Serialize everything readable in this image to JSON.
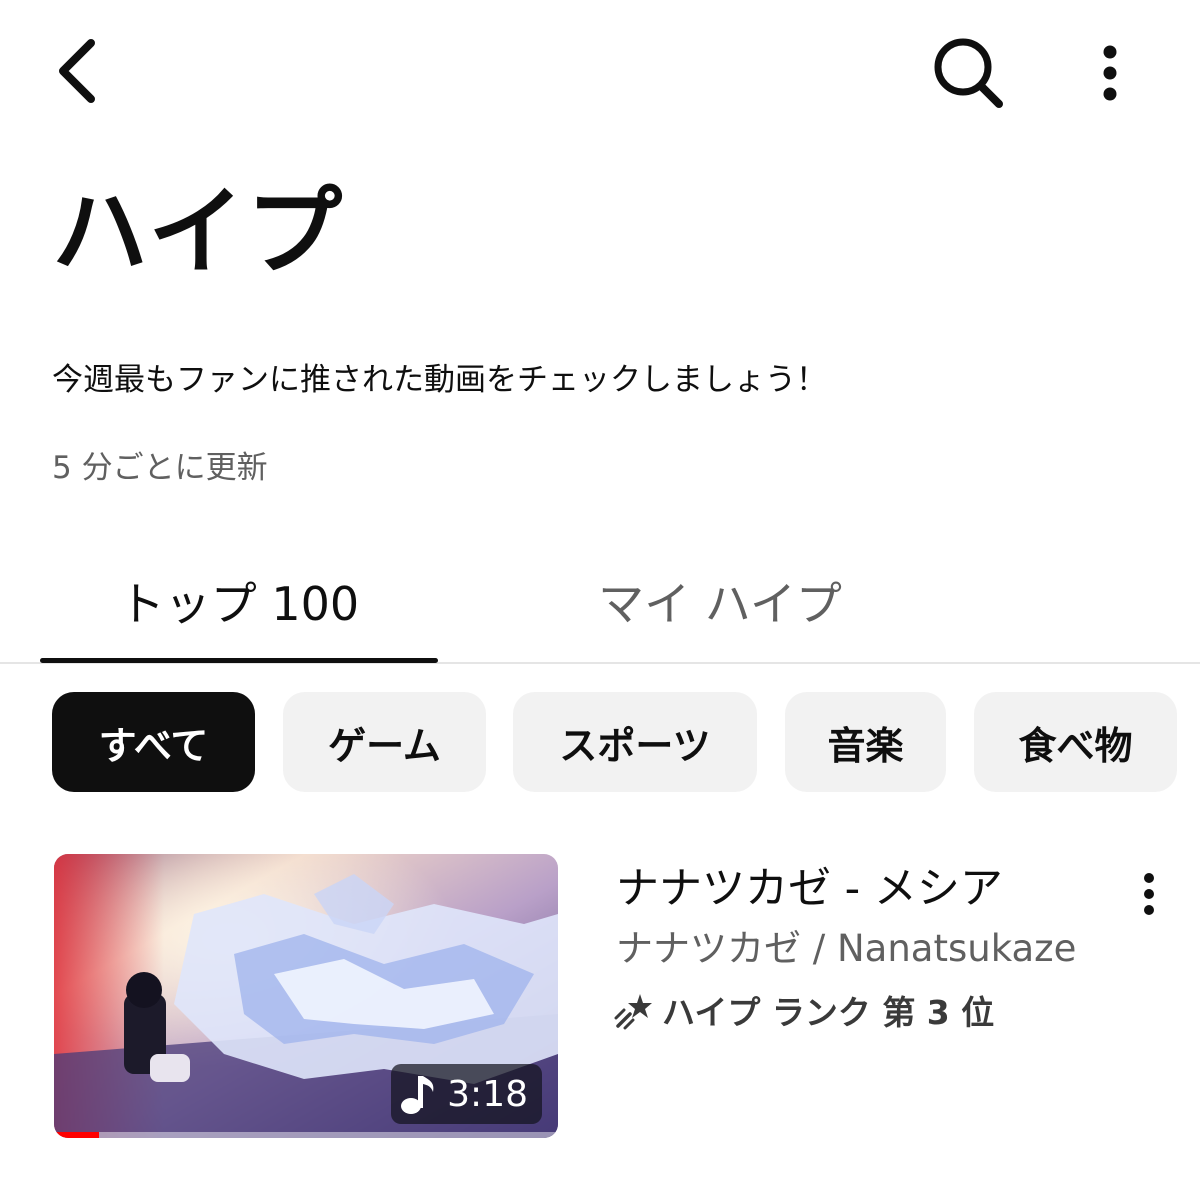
{
  "header": {
    "back_icon": "chevron-left-icon",
    "search_icon": "search-icon",
    "more_icon": "more-vertical-icon"
  },
  "page": {
    "title": "ハイプ",
    "description": "今週最もファンに推された動画をチェックしましょう！",
    "update_note": "5 分ごとに更新"
  },
  "tabs": [
    {
      "label": "トップ 100",
      "selected": true
    },
    {
      "label": "マイ ハイプ",
      "selected": false
    }
  ],
  "chips": [
    {
      "label": "すべて",
      "selected": true
    },
    {
      "label": "ゲーム",
      "selected": false
    },
    {
      "label": "スポーツ",
      "selected": false
    },
    {
      "label": "音楽",
      "selected": false
    },
    {
      "label": "食べ物",
      "selected": false
    }
  ],
  "videos": [
    {
      "title": "ナナツカゼ - メシア",
      "channel": "ナナツカゼ / Nanatsukaze",
      "rank_text": "ハイプ ランク 第 3 位",
      "duration": "3:18",
      "duration_icon": "music-note-icon",
      "rank_icon": "shooting-star-icon",
      "watch_progress": 0.09
    }
  ],
  "colors": {
    "text_primary": "#0f0f0f",
    "text_secondary": "#606060",
    "chip_bg": "#f2f2f2",
    "chip_selected_bg": "#0f0f0f",
    "progress_red": "#ff0000"
  }
}
